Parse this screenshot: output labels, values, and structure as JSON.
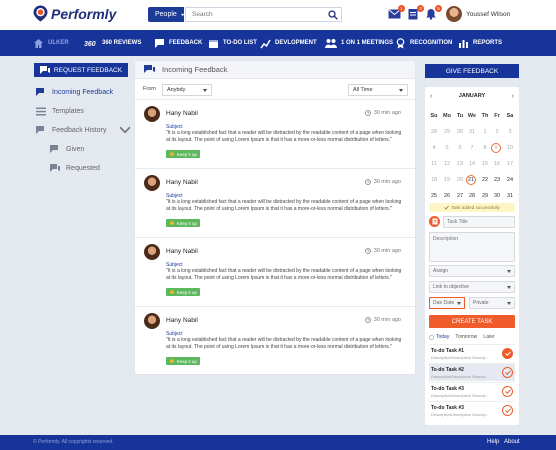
{
  "app": {
    "name": "Performly",
    "footer_copyright": "© Performly. All copyrights reserved.",
    "footer_links": [
      "Help",
      "About"
    ]
  },
  "topbar": {
    "search_scope": "People",
    "search_placeholder": "Search",
    "notifications": [
      {
        "icon": "mail-icon",
        "count": "1"
      },
      {
        "icon": "clipboard-icon",
        "count": "3"
      },
      {
        "icon": "bell-icon",
        "count": "5"
      }
    ],
    "user_name": "Youssef Wilson"
  },
  "nav": [
    {
      "label": "ULKER",
      "icon": "home-icon"
    },
    {
      "label": "360 REVIEWS",
      "icon": "360-icon"
    },
    {
      "label": "FEEDBACK",
      "icon": "feedback-icon"
    },
    {
      "label": "TO-DO LIST",
      "icon": "calendar-icon"
    },
    {
      "label": "DEVLOPMENT",
      "icon": "chart-icon"
    },
    {
      "label": "1 ON 1 MEETINGS",
      "icon": "people-icon"
    },
    {
      "label": "RECOGNITION",
      "icon": "medal-icon"
    },
    {
      "label": "REPORTS",
      "icon": "report-icon"
    }
  ],
  "left": {
    "request_button": "REQUEST FEEDBACK",
    "menu": [
      {
        "label": "Incoming Feedback",
        "icon": "chat-icon",
        "active": true
      },
      {
        "label": "Templates",
        "icon": "list-icon"
      },
      {
        "label": "Feedback History",
        "icon": "history-icon"
      },
      {
        "label": "Given",
        "icon": "chat-given-icon"
      },
      {
        "label": "Requested",
        "icon": "chat-requested-icon"
      }
    ]
  },
  "center": {
    "title": "Incoming Feedback",
    "from_label": "From",
    "from_value": "Anybdy",
    "time_value": "All Time",
    "items": [
      {
        "name": "Hany Nabil",
        "time": "30 min ago",
        "subject": "Subject",
        "body": "\"It is a long established fact that a reader will be distracted  by the readable content of a page when looking at its layout. The point of using Lorem Ipsum is that it has a more-or-less normal distribution of letters.\"",
        "tag": "Keep it up"
      },
      {
        "name": "Hany Nabil",
        "time": "30 min ago",
        "subject": "Subject",
        "body": "\"It is a long established fact that a reader will be distracted  by the readable content of a page when looking at its layout. The point of using Lorem Ipsum is that it has a more-or-less normal distribution of letters.\"",
        "tag": "Keep it up"
      },
      {
        "name": "Hany Nabil",
        "time": "30 min ago",
        "subject": "Subject",
        "body": "\"It is a long established fact that a reader will be distracted  by the readable content of a page when looking at its layout. The point of using Lorem Ipsum is that it has a more-or-less normal distribution of letters.\"",
        "tag": "Keep it up"
      },
      {
        "name": "Hany Nabil",
        "time": "30 min ago",
        "subject": "Subject",
        "body": "\"It is a long established fact that a reader will be distracted  by the readable content of a page when looking at its layout. The point of using Lorem Ipsum is that it has a more-or-less normal distribution of letters.\"",
        "tag": "Keep it up"
      }
    ]
  },
  "right": {
    "give_button": "GIVE FEEDBACK",
    "calendar": {
      "month": "JANUARY",
      "weekdays": [
        "Su",
        "Mo",
        "Tu",
        "We",
        "Th",
        "Fr",
        "Sa"
      ],
      "weeks": [
        [
          "28",
          "29",
          "30",
          "31",
          "1",
          "2",
          "3"
        ],
        [
          "4",
          "5",
          "6",
          "7",
          "8",
          "9",
          "10"
        ],
        [
          "11",
          "12",
          "13",
          "14",
          "15",
          "16",
          "17"
        ],
        [
          "18",
          "19",
          "20",
          "21",
          "22",
          "23",
          "24"
        ],
        [
          "25",
          "26",
          "27",
          "28",
          "29",
          "30",
          "31"
        ]
      ],
      "highlighted": [
        "9",
        "21"
      ]
    },
    "toast": "Task added successfully",
    "task_title_placeholder": "Task Title",
    "description_placeholder": "Description",
    "assign": "Assign",
    "link": "Link to objective",
    "due_date": "Due Date",
    "privacy": "Private",
    "create_button": "CREATE TASK",
    "tabs": [
      "Today",
      "Tomorrow",
      "Later"
    ],
    "todos": [
      {
        "title": "To-do Task #1",
        "desc": "DescriptionDescription Descrip...",
        "done": true
      },
      {
        "title": "To-do Task #2",
        "desc": "DescriptionDescription Descrip...",
        "done": false,
        "selected": true
      },
      {
        "title": "To-do Task #3",
        "desc": "DescriptionDescription Descrip...",
        "done": false
      },
      {
        "title": "To-do Task #3",
        "desc": "DescriptionDescription Descrip...",
        "done": false
      }
    ]
  },
  "colors": {
    "primary": "#17349a",
    "accent": "#ef5b2b",
    "success": "#5cb85c"
  }
}
